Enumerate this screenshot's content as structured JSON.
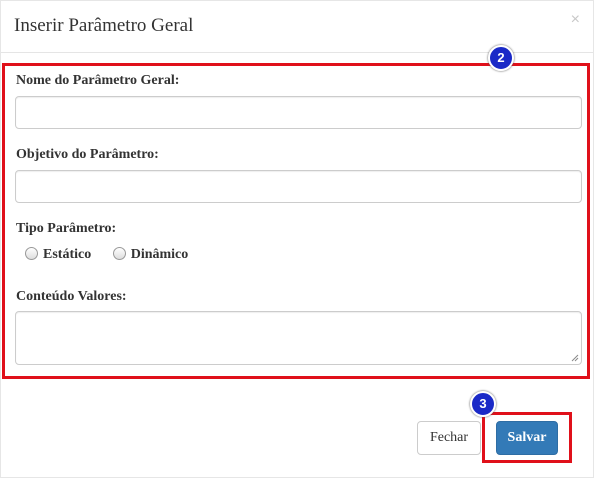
{
  "modal": {
    "title": "Inserir Parâmetro Geral",
    "close_symbol": "×"
  },
  "form": {
    "name_label": "Nome do Parâmetro Geral:",
    "name_value": "",
    "objective_label": "Objetivo do Parâmetro:",
    "objective_value": "",
    "type_label": "Tipo Parâmetro:",
    "type_options": [
      "Estático",
      "Dinâmico"
    ],
    "type_selected": "",
    "values_label": "Conteúdo Valores:",
    "values_value": ""
  },
  "footer": {
    "close_label": "Fechar",
    "save_label": "Salvar"
  },
  "annotations": {
    "badge_form": "2",
    "badge_save": "3",
    "highlight_color": "#e0101a",
    "badge_color": "#1a29c7"
  },
  "colors": {
    "primary_button": "#337ab7"
  }
}
